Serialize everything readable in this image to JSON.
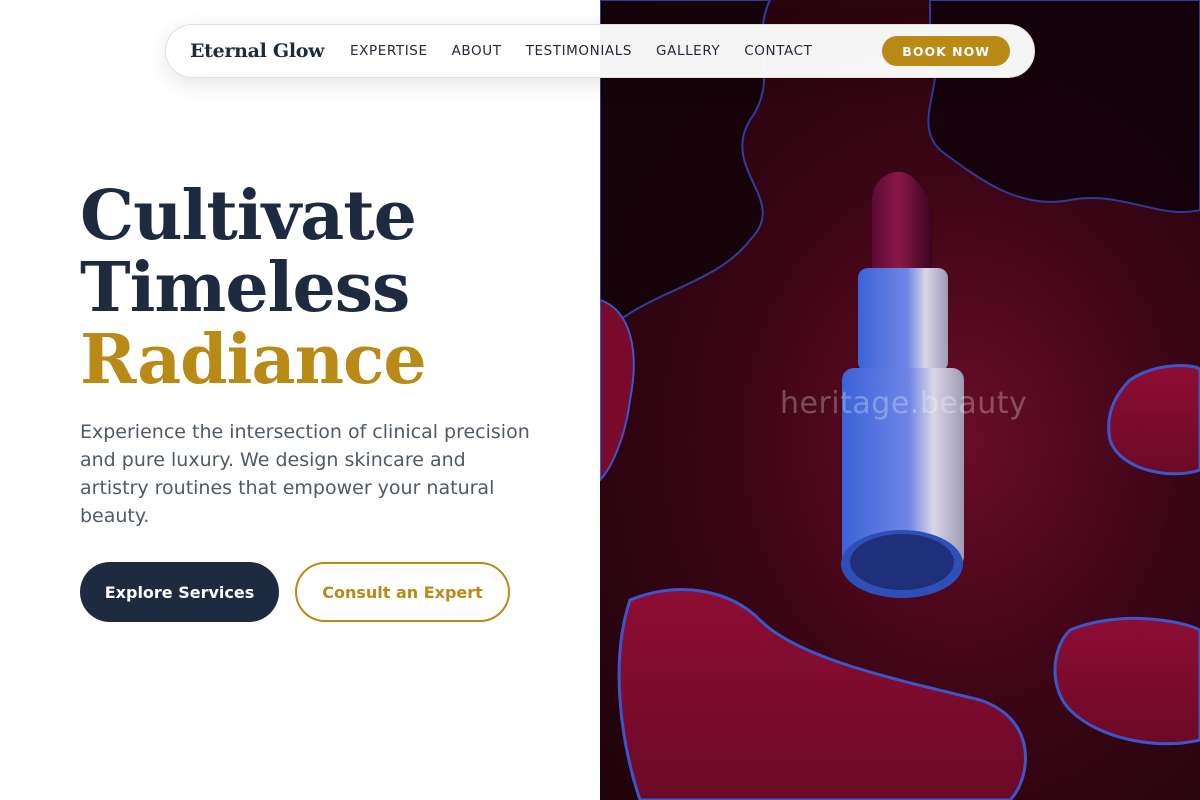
{
  "brand": {
    "name": "Eternal Glow"
  },
  "nav": {
    "links": [
      "EXPERTISE",
      "ABOUT",
      "TESTIMONIALS",
      "GALLERY",
      "CONTACT"
    ],
    "cta": "BOOK NOW"
  },
  "hero": {
    "headline_line1": "Cultivate",
    "headline_line2": "Timeless",
    "headline_accent": "Radiance",
    "lede": "Experience the intersection of clinical precision and pure luxury. We design skincare and artistry routines that empower your natural beauty.",
    "primary_cta": "Explore Services",
    "secondary_cta": "Consult an Expert"
  },
  "image": {
    "watermark": "heritage.beauty",
    "subject_icon": "lipstick-icon"
  },
  "colors": {
    "navy": "#1e2a40",
    "gold": "#b98a16",
    "body_text": "#4f5a66",
    "backdrop": "#3a0514"
  }
}
